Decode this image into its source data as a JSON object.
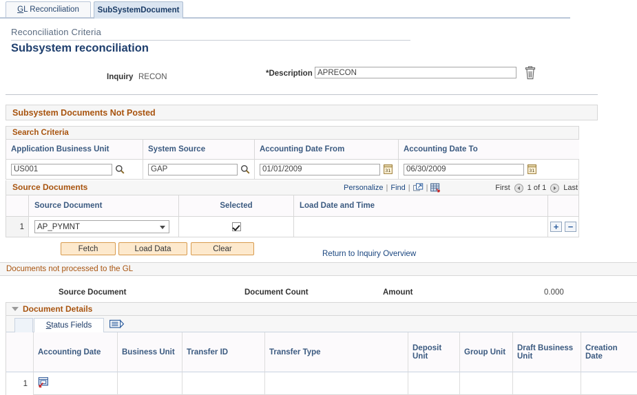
{
  "tabs": [
    {
      "label": "GL Reconciliation",
      "active": false
    },
    {
      "label": "SubSystemDocument",
      "active": true
    }
  ],
  "breadcrumb": "Reconciliation Criteria",
  "page_title": "Subsystem reconciliation",
  "header": {
    "inquiry_label": "Inquiry",
    "inquiry_value": "RECON",
    "description_label": "*Description",
    "description_value": "APRECON",
    "description_placeholder": ""
  },
  "section_not_posted": {
    "title": "Subsystem Documents Not Posted"
  },
  "search_criteria": {
    "title": "Search Criteria",
    "columns": [
      "Application Business Unit",
      "System Source",
      "Accounting Date From",
      "Accounting Date To"
    ],
    "values": {
      "application_business_unit": "US001",
      "system_source": "GAP",
      "accounting_date_from": "01/01/2009",
      "accounting_date_to": "06/30/2009"
    }
  },
  "source_documents": {
    "title": "Source Documents",
    "toolbar": {
      "personalize": "Personalize",
      "find": "Find",
      "view_all_icon": "view-all-icon",
      "download_icon": "download-grid-icon",
      "first": "First",
      "page_indicator": "1 of 1",
      "last": "Last"
    },
    "columns": [
      "Source Document",
      "Selected",
      "Load Date and Time"
    ],
    "rows": [
      {
        "num": "1",
        "source_document": "AP_PYMNT",
        "selected": true,
        "load_date_and_time": "",
        "add_label": "+",
        "delete_label": "−"
      }
    ]
  },
  "actions": {
    "fetch": "Fetch",
    "load_data": "Load Data",
    "clear": "Clear",
    "return_link": "Return to Inquiry Overview"
  },
  "documents_not_processed": {
    "title": "Documents not processed to the GL",
    "summary": {
      "source_document_label": "Source Document",
      "document_count_label": "Document Count",
      "amount_label": "Amount",
      "amount_value": "0.000"
    },
    "details": {
      "title": "Document Details",
      "tab_label": "Status Fields",
      "columns": [
        "Accounting Date",
        "Business Unit",
        "Transfer ID",
        "Transfer Type",
        "Deposit Unit",
        "Group Unit",
        "Draft Business Unit",
        "Creation Date"
      ],
      "rows": [
        {
          "num": "1",
          "accounting_date": "",
          "business_unit": "",
          "transfer_id": "",
          "transfer_type": "",
          "deposit_unit": "",
          "group_unit": "",
          "draft_business_unit": "",
          "creation_date": ""
        }
      ]
    }
  },
  "colors": {
    "section_title": "#a8540f",
    "column_header": "#3b5a80",
    "link": "#19457f",
    "page_title": "#1f3f6e",
    "button_face": "#fde9cd",
    "button_border": "#d79a4d",
    "active_tab": "#dbe5f1"
  }
}
